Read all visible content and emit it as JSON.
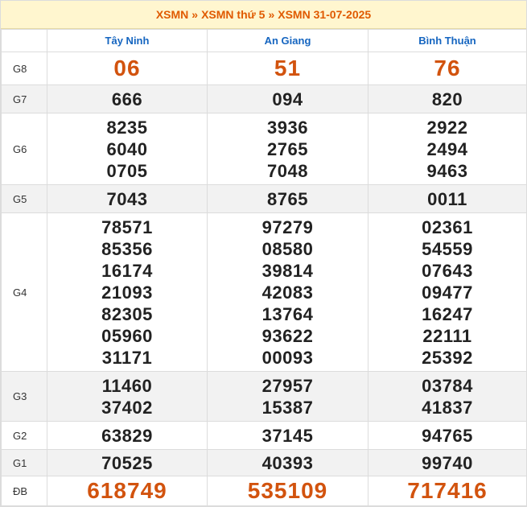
{
  "breadcrumb": {
    "level1": "XSMN",
    "level2": "XSMN thứ 5",
    "level3": "XSMN 31-07-2025",
    "separator": "»"
  },
  "provinces": [
    "Tây Ninh",
    "An Giang",
    "Bình Thuận"
  ],
  "colors": {
    "accent": "#d2530e",
    "header_blue": "#1565c0",
    "title_bg": "#fff6cf"
  },
  "prizes": [
    {
      "id": "g8",
      "label": "G8",
      "values": [
        [
          "06"
        ],
        [
          "51"
        ],
        [
          "76"
        ]
      ],
      "highlight": true
    },
    {
      "id": "g7",
      "label": "G7",
      "values": [
        [
          "666"
        ],
        [
          "094"
        ],
        [
          "820"
        ]
      ]
    },
    {
      "id": "g6",
      "label": "G6",
      "values": [
        [
          "8235",
          "6040",
          "0705"
        ],
        [
          "3936",
          "2765",
          "7048"
        ],
        [
          "2922",
          "2494",
          "9463"
        ]
      ]
    },
    {
      "id": "g5",
      "label": "G5",
      "values": [
        [
          "7043"
        ],
        [
          "8765"
        ],
        [
          "0011"
        ]
      ]
    },
    {
      "id": "g4",
      "label": "G4",
      "values": [
        [
          "78571",
          "85356",
          "16174",
          "21093",
          "82305",
          "05960",
          "31171"
        ],
        [
          "97279",
          "08580",
          "39814",
          "42083",
          "13764",
          "93622",
          "00093"
        ],
        [
          "02361",
          "54559",
          "07643",
          "09477",
          "16247",
          "22111",
          "25392"
        ]
      ]
    },
    {
      "id": "g3",
      "label": "G3",
      "values": [
        [
          "11460",
          "37402"
        ],
        [
          "27957",
          "15387"
        ],
        [
          "03784",
          "41837"
        ]
      ]
    },
    {
      "id": "g2",
      "label": "G2",
      "values": [
        [
          "63829"
        ],
        [
          "37145"
        ],
        [
          "94765"
        ]
      ]
    },
    {
      "id": "g1",
      "label": "G1",
      "values": [
        [
          "70525"
        ],
        [
          "40393"
        ],
        [
          "99740"
        ]
      ]
    },
    {
      "id": "db",
      "label": "ĐB",
      "values": [
        [
          "618749"
        ],
        [
          "535109"
        ],
        [
          "717416"
        ]
      ],
      "highlight": true
    }
  ]
}
